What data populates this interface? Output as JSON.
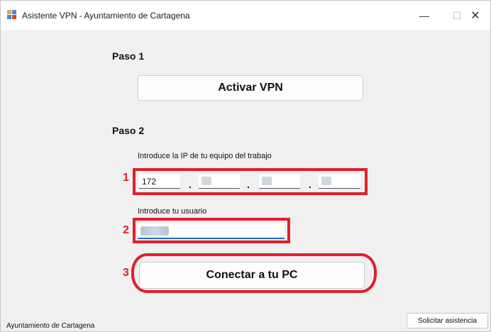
{
  "window": {
    "title": "Asistente VPN - Ayuntamiento de Cartagena",
    "minimize_glyph": "—",
    "maximize_glyph": "☐",
    "close_glyph": "✕"
  },
  "step1": {
    "label": "Paso 1",
    "button": "Activar VPN"
  },
  "step2": {
    "label": "Paso 2",
    "ip_label": "Introduce la IP de tu equipo del trabajo",
    "ip_octets": [
      "172",
      "",
      "",
      ""
    ],
    "ip_separator": ".",
    "user_label": "Introduce tu usuario",
    "user_value": "",
    "connect_button": "Conectar a tu PC"
  },
  "annotations": {
    "color": "#e0202a",
    "numbers": [
      "1",
      "2",
      "3"
    ]
  },
  "footer": {
    "org": "Ayuntamiento de Cartagena",
    "assist_button": "Solicitar asistencia"
  }
}
